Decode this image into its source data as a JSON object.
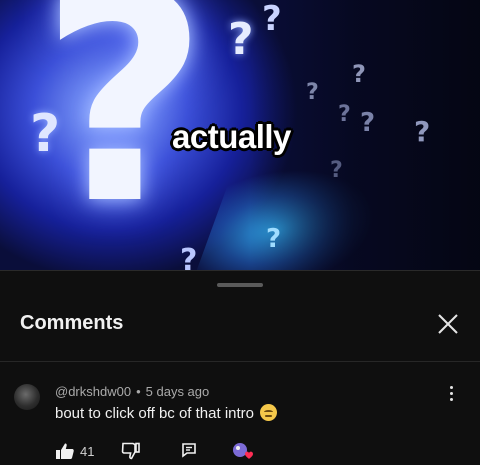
{
  "video": {
    "caption": "actually",
    "glyphs": [
      "?",
      "?",
      "?",
      "?",
      "?",
      "?",
      "?",
      "?",
      "?",
      "?",
      "?",
      "?"
    ]
  },
  "comments_panel": {
    "title": "Comments",
    "close_icon": "close-icon"
  },
  "comment": {
    "author": "@drkshdw00",
    "separator": "•",
    "time": "5 days ago",
    "text": "bout to click off bc of that intro",
    "emoji_icon": "smirk-emoji-icon",
    "like_count": "41"
  },
  "colors": {
    "background": "#0f0f0f",
    "text_primary": "#f1f1f1",
    "text_secondary": "#aaaaaa"
  }
}
